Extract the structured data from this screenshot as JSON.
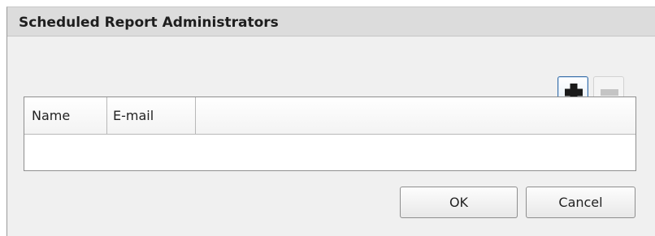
{
  "dialog": {
    "title": "Scheduled Report Administrators"
  },
  "toolbar": {
    "add_icon": "plus-icon",
    "remove_icon": "minus-icon",
    "remove_enabled": false
  },
  "grid": {
    "columns": [
      "Name",
      "E-mail"
    ],
    "rows": []
  },
  "buttons": {
    "ok_label": "OK",
    "cancel_label": "Cancel"
  },
  "colors": {
    "add_icon": "#1a1a1a",
    "remove_icon_disabled": "#c4c4c4",
    "accent_border": "#3a6fa8"
  }
}
